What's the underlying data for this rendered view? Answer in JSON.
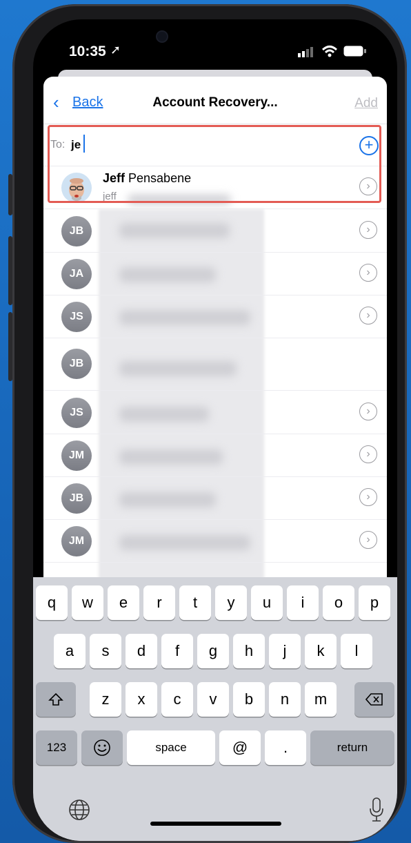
{
  "status_bar": {
    "time": "10:35"
  },
  "nav": {
    "back_label": "Back",
    "title": "Account Recovery...",
    "add_label": "Add"
  },
  "to_field": {
    "label": "To:",
    "value": "je"
  },
  "suggestion": {
    "first_name": "Jeff",
    "last_name": " Pensabene",
    "email_visible": "jeff"
  },
  "contacts": [
    {
      "initials": "JB",
      "has_chevron": true
    },
    {
      "initials": "JA",
      "has_chevron": true
    },
    {
      "initials": "JS",
      "has_chevron": true
    },
    {
      "initials": "JB",
      "has_chevron": false
    },
    {
      "initials": "JS",
      "has_chevron": true
    },
    {
      "initials": "JM",
      "has_chevron": true
    },
    {
      "initials": "JB",
      "has_chevron": true
    },
    {
      "initials": "JM",
      "has_chevron": true
    }
  ],
  "keyboard": {
    "row1": [
      "q",
      "w",
      "e",
      "r",
      "t",
      "y",
      "u",
      "i",
      "o",
      "p"
    ],
    "row2": [
      "a",
      "s",
      "d",
      "f",
      "g",
      "h",
      "j",
      "k",
      "l"
    ],
    "row3": [
      "z",
      "x",
      "c",
      "v",
      "b",
      "n",
      "m"
    ],
    "numbers_label": "123",
    "space_label": "space",
    "at_label": "@",
    "period_label": ".",
    "return_label": "return"
  },
  "colors": {
    "accent": "#1a73e8",
    "highlight": "#e35b54",
    "background": "#1f78cf"
  }
}
